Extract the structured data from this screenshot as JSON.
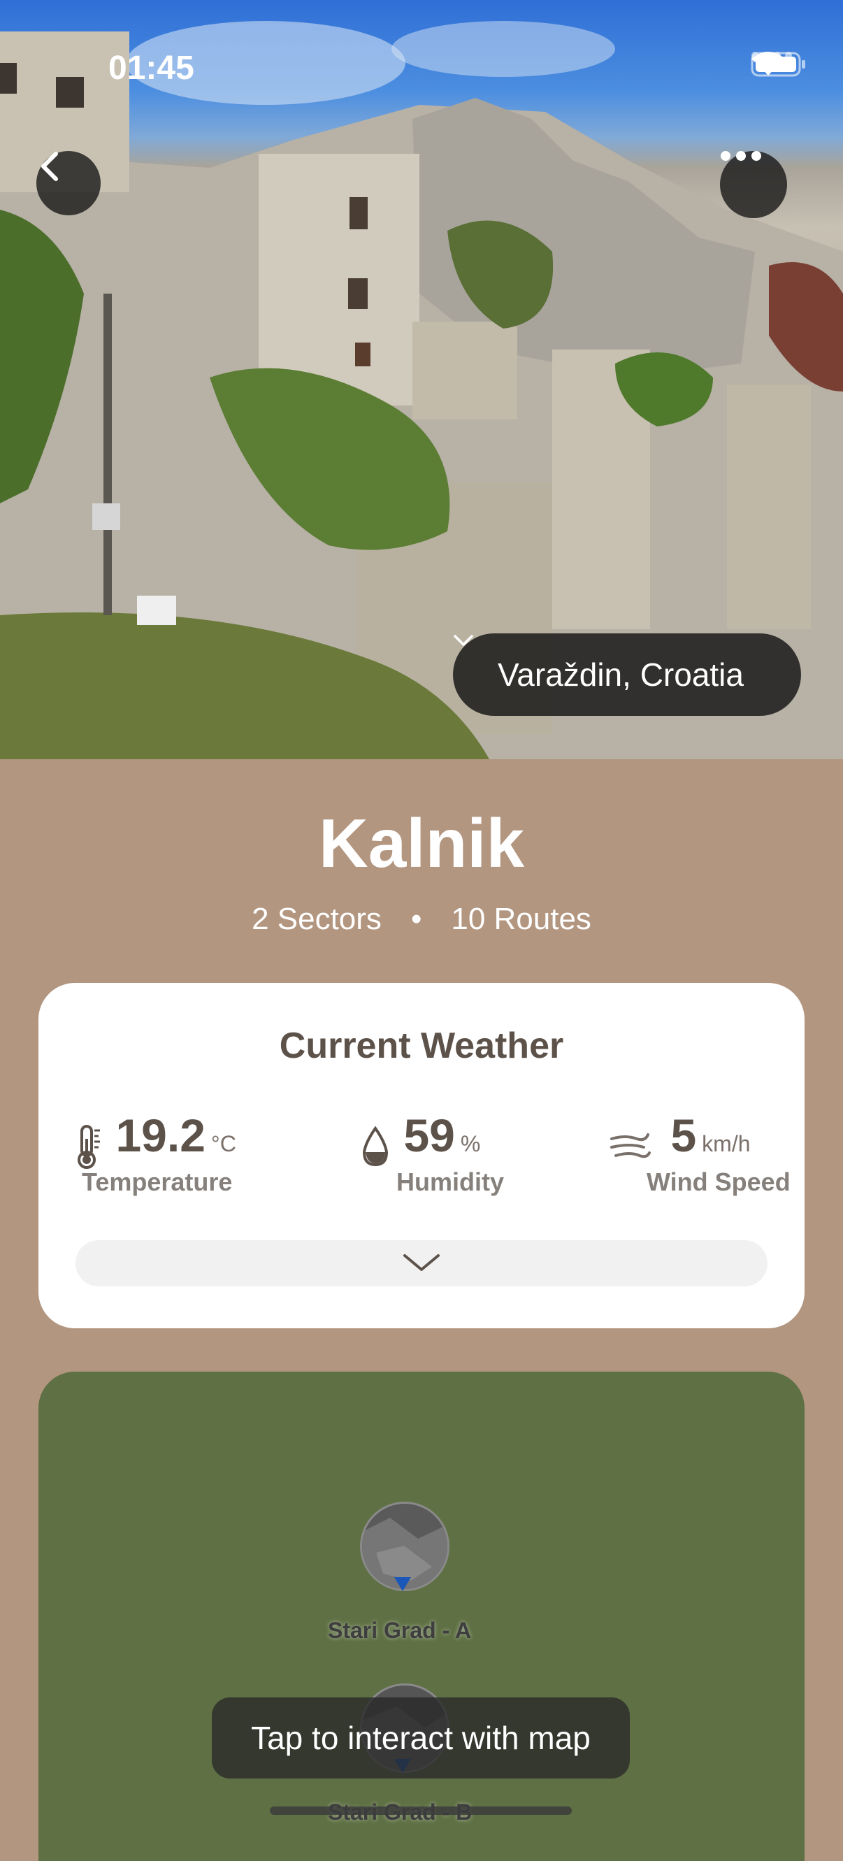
{
  "status_bar": {
    "time": "01:45"
  },
  "hero": {
    "location": "Varaždin, Croatia"
  },
  "crag": {
    "name": "Kalnik",
    "sectors": "2 Sectors",
    "separator": "•",
    "routes": "10 Routes"
  },
  "weather": {
    "title": "Current Weather",
    "temperature": {
      "value": "19.2",
      "unit": "°C",
      "label": "Temperature"
    },
    "humidity": {
      "value": "59",
      "unit": "%",
      "label": "Humidity"
    },
    "wind": {
      "value": "5",
      "unit": "km/h",
      "label": "Wind Speed"
    }
  },
  "map": {
    "sectors": [
      {
        "name": "Stari Grad - A"
      },
      {
        "name": "Stari Grad - B"
      }
    ],
    "hint": "Tap to interact with map"
  },
  "icons": [
    "back-chevron-icon",
    "more-icon",
    "wifi-icon",
    "battery-icon",
    "thermometer-icon",
    "drop-icon",
    "wind-icon",
    "chevron-down-icon"
  ]
}
